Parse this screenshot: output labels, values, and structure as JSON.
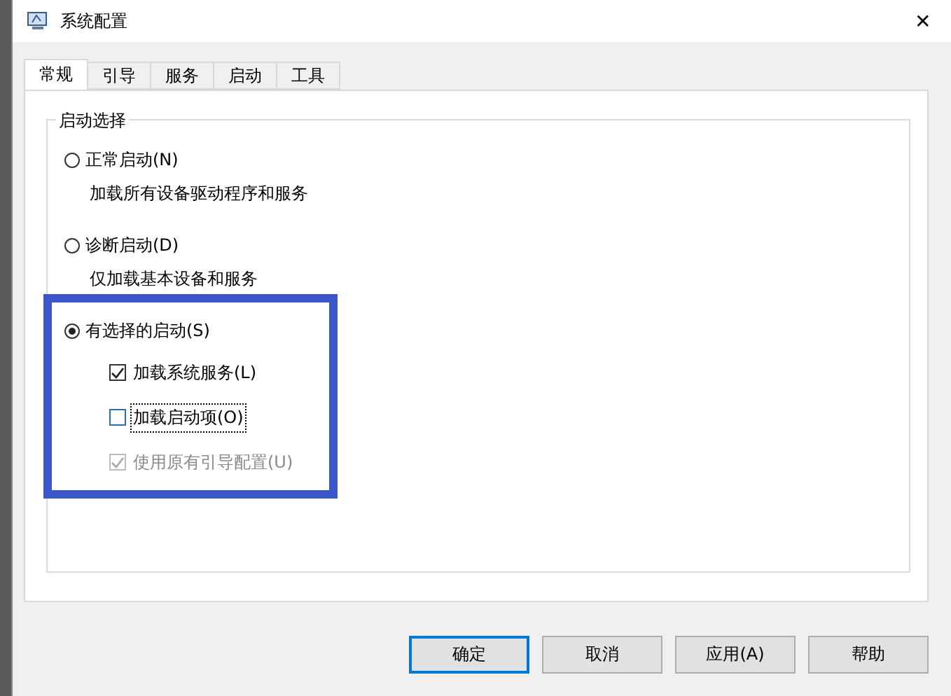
{
  "window": {
    "title": "系统配置",
    "close": "✕"
  },
  "tabs": [
    {
      "label": "常规",
      "selected": true
    },
    {
      "label": "引导",
      "selected": false
    },
    {
      "label": "服务",
      "selected": false
    },
    {
      "label": "启动",
      "selected": false
    },
    {
      "label": "工具",
      "selected": false
    }
  ],
  "group": {
    "title": "启动选择",
    "options": [
      {
        "label": "正常启动(N)",
        "selected": false,
        "description": "加载所有设备驱动程序和服务"
      },
      {
        "label": "诊断启动(D)",
        "selected": false,
        "description": "仅加载基本设备和服务"
      },
      {
        "label": "有选择的启动(S)",
        "selected": true,
        "highlighted": true,
        "checkboxes": [
          {
            "label": "加载系统服务(L)",
            "checked": true,
            "disabled": false,
            "focused": false
          },
          {
            "label": "加载启动项(O)",
            "checked": false,
            "disabled": false,
            "focused": true
          },
          {
            "label": "使用原有引导配置(U)",
            "checked": true,
            "disabled": true,
            "focused": false
          }
        ]
      }
    ]
  },
  "buttons": [
    {
      "label": "确定",
      "default": true
    },
    {
      "label": "取消",
      "default": false
    },
    {
      "label": "应用(A)",
      "default": false
    },
    {
      "label": "帮助",
      "default": false
    }
  ]
}
